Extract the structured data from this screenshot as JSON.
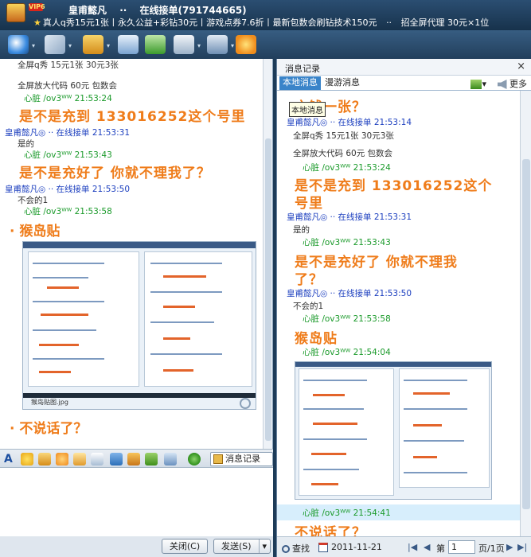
{
  "window": {
    "vip_badge": "VIP6",
    "title_name": "皇甫懿凡",
    "title_separator": "··",
    "title_status": "在线接单(791744665)",
    "signature": "真人q秀15元1张丨永久公益+彩钻30元丨游戏点券7.6折丨最新包数会刷钻技术150元",
    "signature_sep": "··",
    "signature_tail": "招全屏代理 30元×1位"
  },
  "left_chat": [
    {
      "type": "small",
      "text": "全屏q秀  15元1张  30元3张"
    },
    {
      "type": "small",
      "text": "全屏放大代码  60元  包数会"
    },
    {
      "type": "green",
      "text": "心脏  /ov3ᵂᵂ       21:53:24"
    },
    {
      "type": "big",
      "text": "是不是充到 133016252这个号里"
    },
    {
      "type": "hdr",
      "text": "皇甫懿凡◎   ··    在线接单    21:53:31"
    },
    {
      "type": "small",
      "text": "是的"
    },
    {
      "type": "green",
      "text": "心脏  /ov3ᵂᵂ       21:53:43"
    },
    {
      "type": "big",
      "text": "是不是充好了  你就不理我了？"
    },
    {
      "type": "hdr",
      "text": "皇甫懿凡◎   ··    在线接单    21:53:50"
    },
    {
      "type": "small",
      "text": "不会的1"
    },
    {
      "type": "green",
      "text": "心脏  /ov3ᵂᵂ       21:53:58"
    },
    {
      "type": "big",
      "text": "· 猴岛贴"
    },
    {
      "type": "big",
      "text": "· 不说话了？"
    }
  ],
  "left_image_caption": "猴岛贴图.jpg",
  "format_bar": {
    "history_label": "消息记录"
  },
  "bottom_buttons": {
    "close": "关闭(C)",
    "send": "发送(S)"
  },
  "right_panel": {
    "title": "消息记录",
    "close_glyph": "×",
    "tab_local": "本地消息",
    "tab_roam": "漫游消息",
    "more_label": "更多",
    "tooltip": "本地消息",
    "partial_top": "充钱一张？",
    "messages": [
      {
        "type": "hdr",
        "text": "皇甫懿凡◎   ··    在线接单    21:53:14"
      },
      {
        "type": "small",
        "text": "全屏q秀  15元1张  30元3张"
      },
      {
        "type": "small",
        "text": "全屏放大代码  60元  包数会"
      },
      {
        "type": "green",
        "text": "心脏  /ov3ᵂᵂ       21:53:24"
      },
      {
        "type": "big",
        "text": "是不是充到 133016252这个"
      },
      {
        "type": "big",
        "text": "号里"
      },
      {
        "type": "hdr",
        "text": "皇甫懿凡◎   ··    在线接单    21:53:31"
      },
      {
        "type": "small",
        "text": "是的"
      },
      {
        "type": "green",
        "text": "心脏  /ov3ᵂᵂ       21:53:43"
      },
      {
        "type": "big",
        "text": "是不是充好了  你就不理我"
      },
      {
        "type": "big",
        "text": "了？"
      },
      {
        "type": "hdr",
        "text": "皇甫懿凡◎   ··    在线接单    21:53:50"
      },
      {
        "type": "small",
        "text": "不会的1"
      },
      {
        "type": "green",
        "text": "心脏  /ov3ᵂᵂ       21:53:58"
      },
      {
        "type": "big",
        "text": "猴岛贴"
      },
      {
        "type": "green",
        "text": "心脏  /ov3ᵂᵂ       21:54:04"
      },
      {
        "type": "green",
        "text": "心脏  /ov3ᵂᵂ       21:54:41"
      },
      {
        "type": "big",
        "text": "不说话了？"
      }
    ],
    "footer": {
      "search": "查找",
      "date": "2011-11-21",
      "page_prefix": "第",
      "page_value": "1",
      "page_suffix": "页/1页"
    }
  }
}
